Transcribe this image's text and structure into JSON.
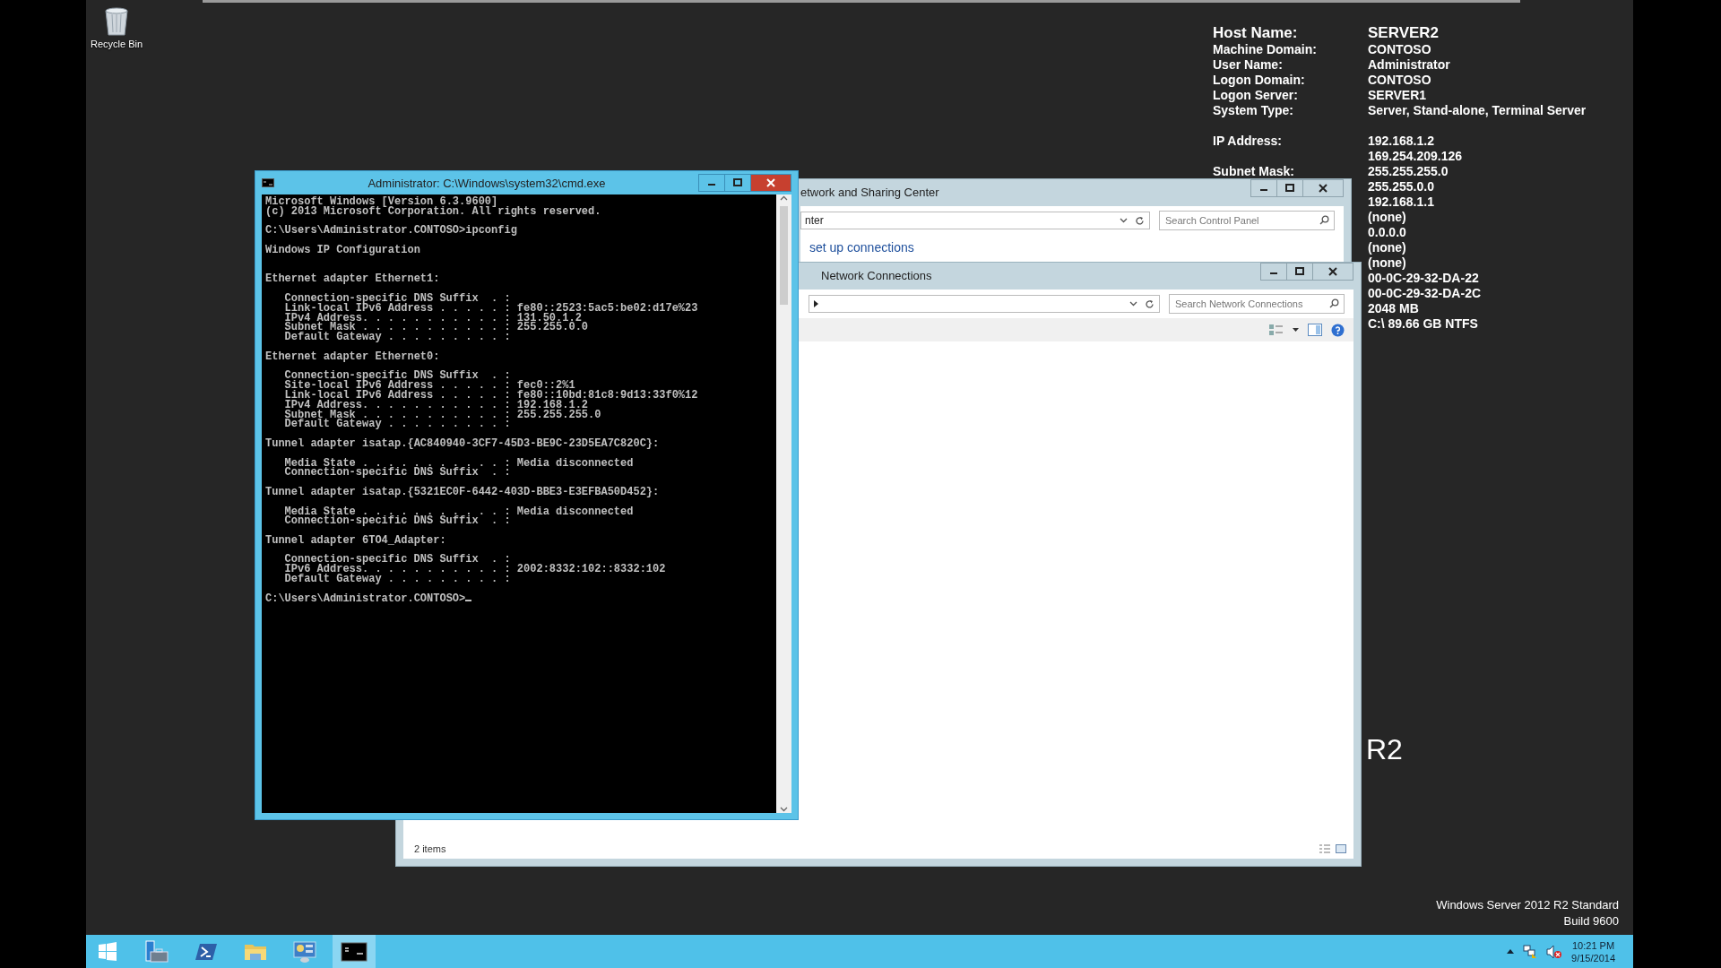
{
  "desktop": {
    "icons": [
      {
        "label": "Recycle Bin"
      }
    ],
    "branding": {
      "edition_mark": "R2",
      "edition": "Windows Server 2012 R2 Standard",
      "build": "Build 9600"
    }
  },
  "bginfo": {
    "rows": [
      {
        "kind": "headline",
        "label": "Host Name:",
        "value": "SERVER2"
      },
      {
        "kind": "field",
        "label": "Machine Domain:",
        "value": "CONTOSO"
      },
      {
        "kind": "field",
        "label": "User Name:",
        "value": "Administrator"
      },
      {
        "kind": "field",
        "label": "Logon Domain:",
        "value": "CONTOSO"
      },
      {
        "kind": "field",
        "label": "Logon Server:",
        "value": "SERVER1"
      },
      {
        "kind": "field",
        "label": "System Type:",
        "value": "Server, Stand-alone, Terminal Server"
      },
      {
        "kind": "section",
        "label": "IP Address:",
        "value": "192.168.1.2"
      },
      {
        "kind": "field",
        "value": "169.254.209.126"
      },
      {
        "kind": "field",
        "label": "Subnet Mask:",
        "value": "255.255.255.0"
      },
      {
        "kind": "field",
        "value": "255.255.0.0"
      },
      {
        "kind": "field",
        "value": "192.168.1.1"
      },
      {
        "kind": "field",
        "value": "(none)"
      },
      {
        "kind": "field",
        "value": "0.0.0.0"
      },
      {
        "kind": "field",
        "value": "(none)"
      },
      {
        "kind": "field",
        "value": "(none)"
      },
      {
        "kind": "field",
        "value": "00-0C-29-32-DA-22"
      },
      {
        "kind": "field",
        "value": "00-0C-29-32-DA-2C"
      },
      {
        "kind": "field",
        "value": "2048 MB"
      },
      {
        "kind": "field",
        "value": "C:\\ 89.66 GB NTFS"
      }
    ]
  },
  "sharing_center_window": {
    "title": "etwork and Sharing Center",
    "address": "nter",
    "placeholder": "Search Control Panel",
    "link": "set up connections"
  },
  "network_connections_window": {
    "title": "Network Connections",
    "placeholder": "Search Network Connections",
    "status": "2 items"
  },
  "cmd_window": {
    "title": "Administrator: C:\\Windows\\system32\\cmd.exe",
    "blocks": [
      {
        "kind": "plain",
        "lines": [
          "Microsoft Windows [Version 6.3.9600]",
          "(c) 2013 Microsoft Corporation. All rights reserved."
        ]
      },
      {
        "kind": "plain",
        "lines": [
          "C:\\Users\\Administrator.CONTOSO>ipconfig"
        ]
      },
      {
        "kind": "title",
        "lines": [
          "Windows IP Configuration"
        ]
      },
      {
        "kind": "plain",
        "lines": [
          "Ethernet adapter Ethernet1:"
        ]
      },
      {
        "kind": "detail",
        "lines": [
          "Connection-specific DNS Suffix  . :",
          "Link-local IPv6 Address . . . . . : fe80::2523:5ac5:be02:d17e%23",
          "IPv4 Address. . . . . . . . . . . : 131.50.1.2",
          "Subnet Mask . . . . . . . . . . . : 255.255.0.0",
          "Default Gateway . . . . . . . . . :"
        ]
      },
      {
        "kind": "plain",
        "lines": [
          "Ethernet adapter Ethernet0:"
        ]
      },
      {
        "kind": "detail",
        "lines": [
          "Connection-specific DNS Suffix  . :",
          "Site-local IPv6 Address . . . . . : fec0::2%1",
          "Link-local IPv6 Address . . . . . : fe80::10bd:81c8:9d13:33f0%12",
          "IPv4 Address. . . . . . . . . . . : 192.168.1.2",
          "Subnet Mask . . . . . . . . . . . : 255.255.255.0",
          "Default Gateway . . . . . . . . . :"
        ]
      },
      {
        "kind": "plain",
        "lines": [
          "Tunnel adapter isatap.{AC840940-3CF7-45D3-BE9C-23D5EA7C820C}:"
        ]
      },
      {
        "kind": "detail",
        "lines": [
          "Media State . . . . . . . . . . . : Media disconnected",
          "Connection-specific DNS Suffix  . :"
        ]
      },
      {
        "kind": "plain",
        "lines": [
          "Tunnel adapter isatap.{5321EC0F-6442-403D-BBE3-E3EFBA50D452}:"
        ]
      },
      {
        "kind": "detail",
        "lines": [
          "Media State . . . . . . . . . . . : Media disconnected",
          "Connection-specific DNS Suffix  . :"
        ]
      },
      {
        "kind": "plain",
        "lines": [
          "Tunnel adapter 6TO4_Adapter:"
        ]
      },
      {
        "kind": "detail",
        "lines": [
          "Connection-specific DNS Suffix  . :",
          "IPv6 Address. . . . . . . . . . . : 2002:8332:102::8332:102",
          "Default Gateway . . . . . . . . . :"
        ]
      },
      {
        "kind": "prompt",
        "lines": [
          "C:\\Users\\Administrator.CONTOSO>"
        ]
      }
    ]
  },
  "taskbar": {
    "apps": [
      {
        "kind": "start",
        "selected": false
      },
      {
        "kind": "server-manager",
        "selected": false
      },
      {
        "kind": "powershell",
        "selected": false
      },
      {
        "kind": "explorer",
        "selected": false
      },
      {
        "kind": "control-panel",
        "selected": false
      },
      {
        "kind": "console",
        "selected": true
      }
    ],
    "tray": {
      "time": "10:21 PM",
      "date": "9/15/2014"
    }
  }
}
